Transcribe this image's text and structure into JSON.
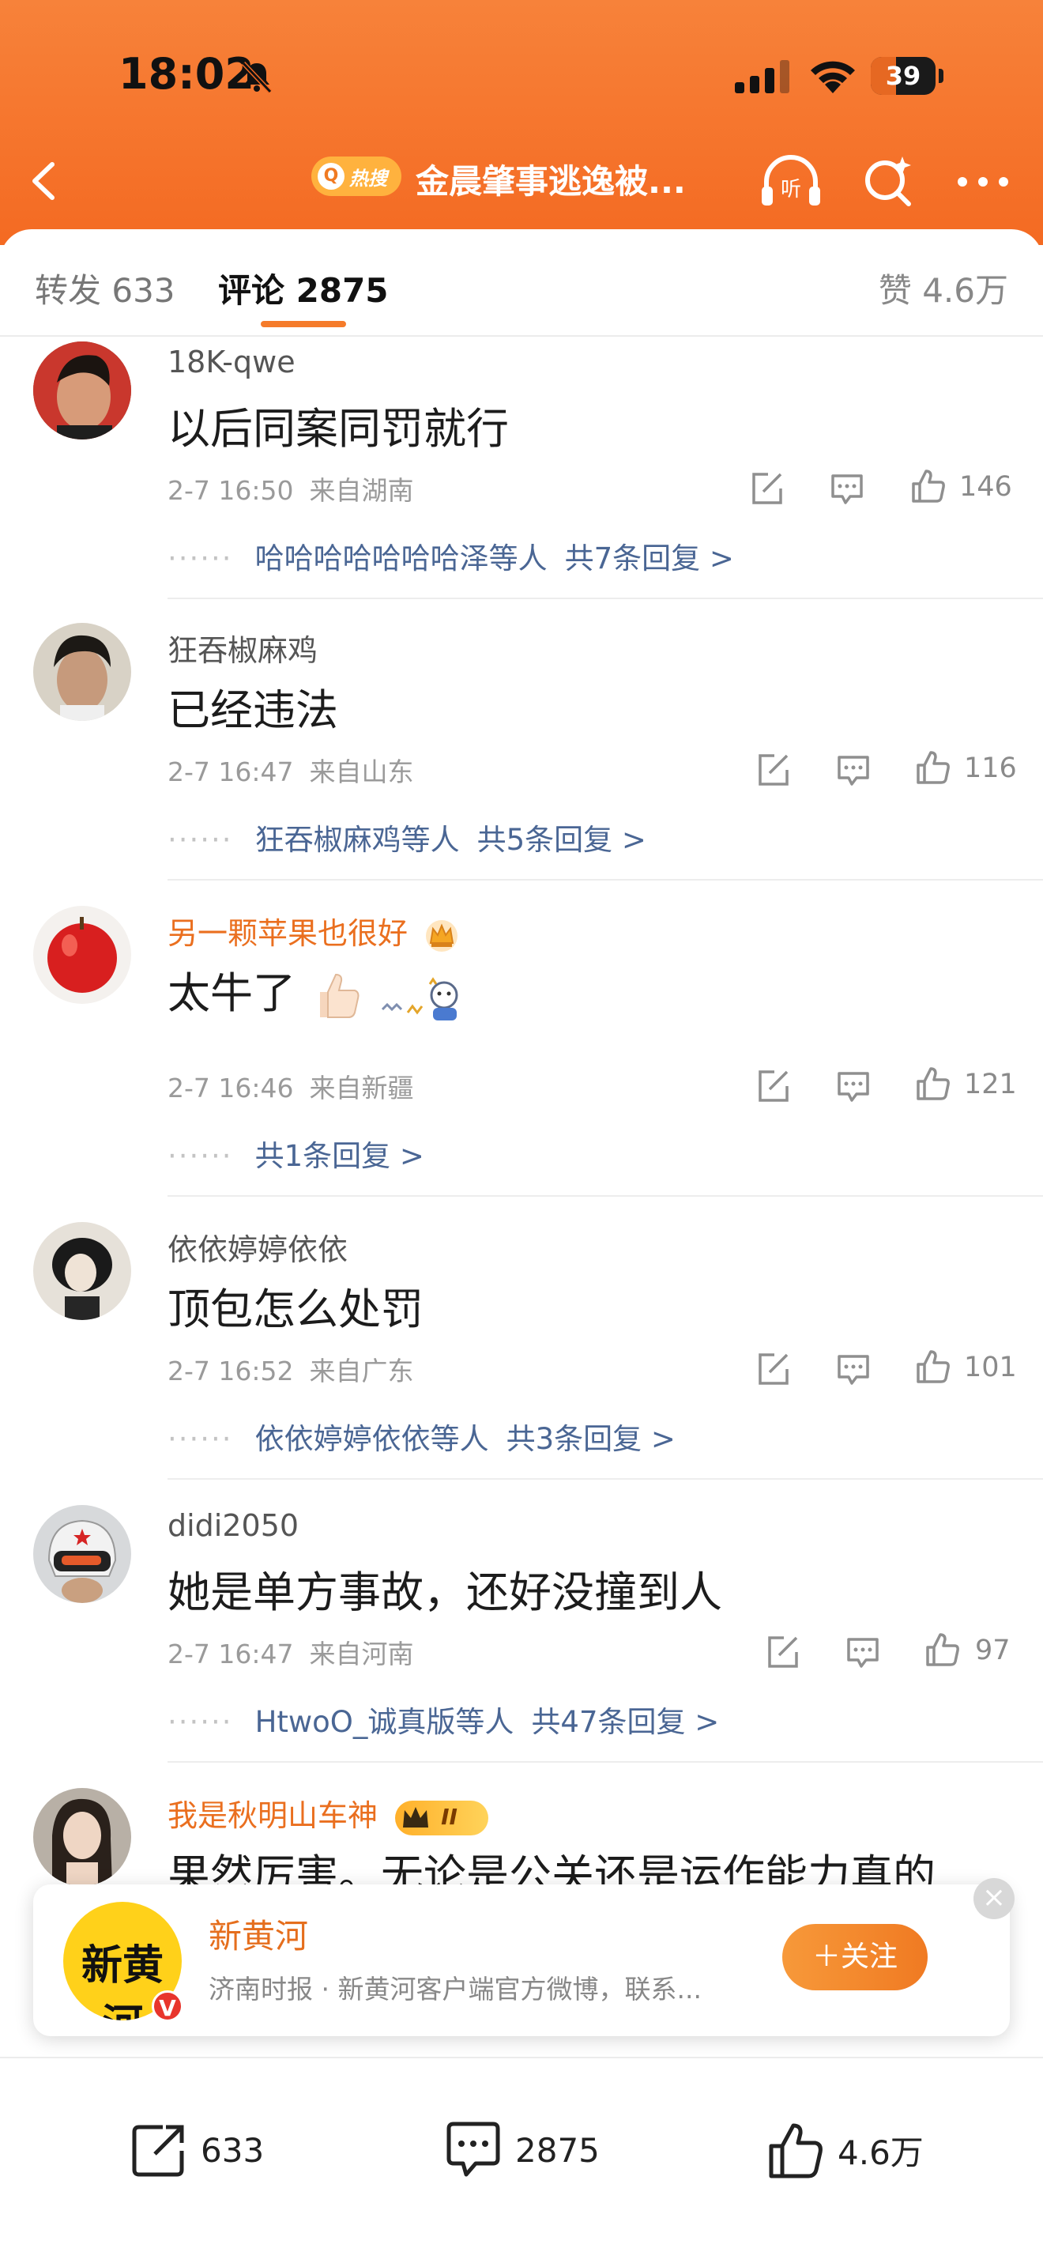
{
  "status_bar": {
    "time": "18:02",
    "battery": "39",
    "battery_level": 0.39
  },
  "nav": {
    "hot_label": "热搜",
    "title": "金晨肇事逃逸被..."
  },
  "tabs": {
    "forward": "转发 633",
    "comments": "评论 2875",
    "likes": "赞 4.6万"
  },
  "comments": [
    {
      "user": "18K-qwe",
      "text": "以后同案同罚就行",
      "time": "2-7 16:50",
      "location": "来自湖南",
      "likes": "146",
      "reply_users": "哈哈哈哈哈哈哈泽等人",
      "reply_count": "共7条回复 >"
    },
    {
      "user": "狂吞椒麻鸡",
      "text": "已经违法",
      "time": "2-7 16:47",
      "location": "来自山东",
      "likes": "116",
      "reply_users": "狂吞椒麻鸡等人",
      "reply_count": "共5条回复 >"
    },
    {
      "user": "另一颗苹果也很好",
      "text": "太牛了",
      "time": "2-7 16:46",
      "location": "来自新疆",
      "likes": "121",
      "reply_users": "",
      "reply_count": "共1条回复 >"
    },
    {
      "user": "依依婷婷依依",
      "text": "顶包怎么处罚",
      "time": "2-7 16:52",
      "location": "来自广东",
      "likes": "101",
      "reply_users": "依依婷婷依依等人",
      "reply_count": "共3条回复 >"
    },
    {
      "user": "didi2050",
      "text": "她是单方事故，还好没撞到人",
      "time": "2-7 16:47",
      "location": "来自河南",
      "likes": "97",
      "reply_users": "HtwoO_诚真版等人",
      "reply_count": "共47条回复 >"
    },
    {
      "user": "我是秋明山车神",
      "text": "果然厉害。无论是公关还是运作能力真的",
      "badge_level": "II"
    }
  ],
  "reply_dots": "······",
  "promo": {
    "name": "新黄河",
    "logo_text": "新黄河",
    "description": "济南时报 · 新黄河客户端官方微博，联系...",
    "follow": "＋关注",
    "close": "×"
  },
  "bottom_bar": {
    "forward": "633",
    "comments": "2875",
    "likes": "4.6万"
  },
  "colors": {
    "brand_orange": "#f46a22",
    "link_blue": "#4a6694",
    "vip_orange": "#ea6f1f"
  }
}
